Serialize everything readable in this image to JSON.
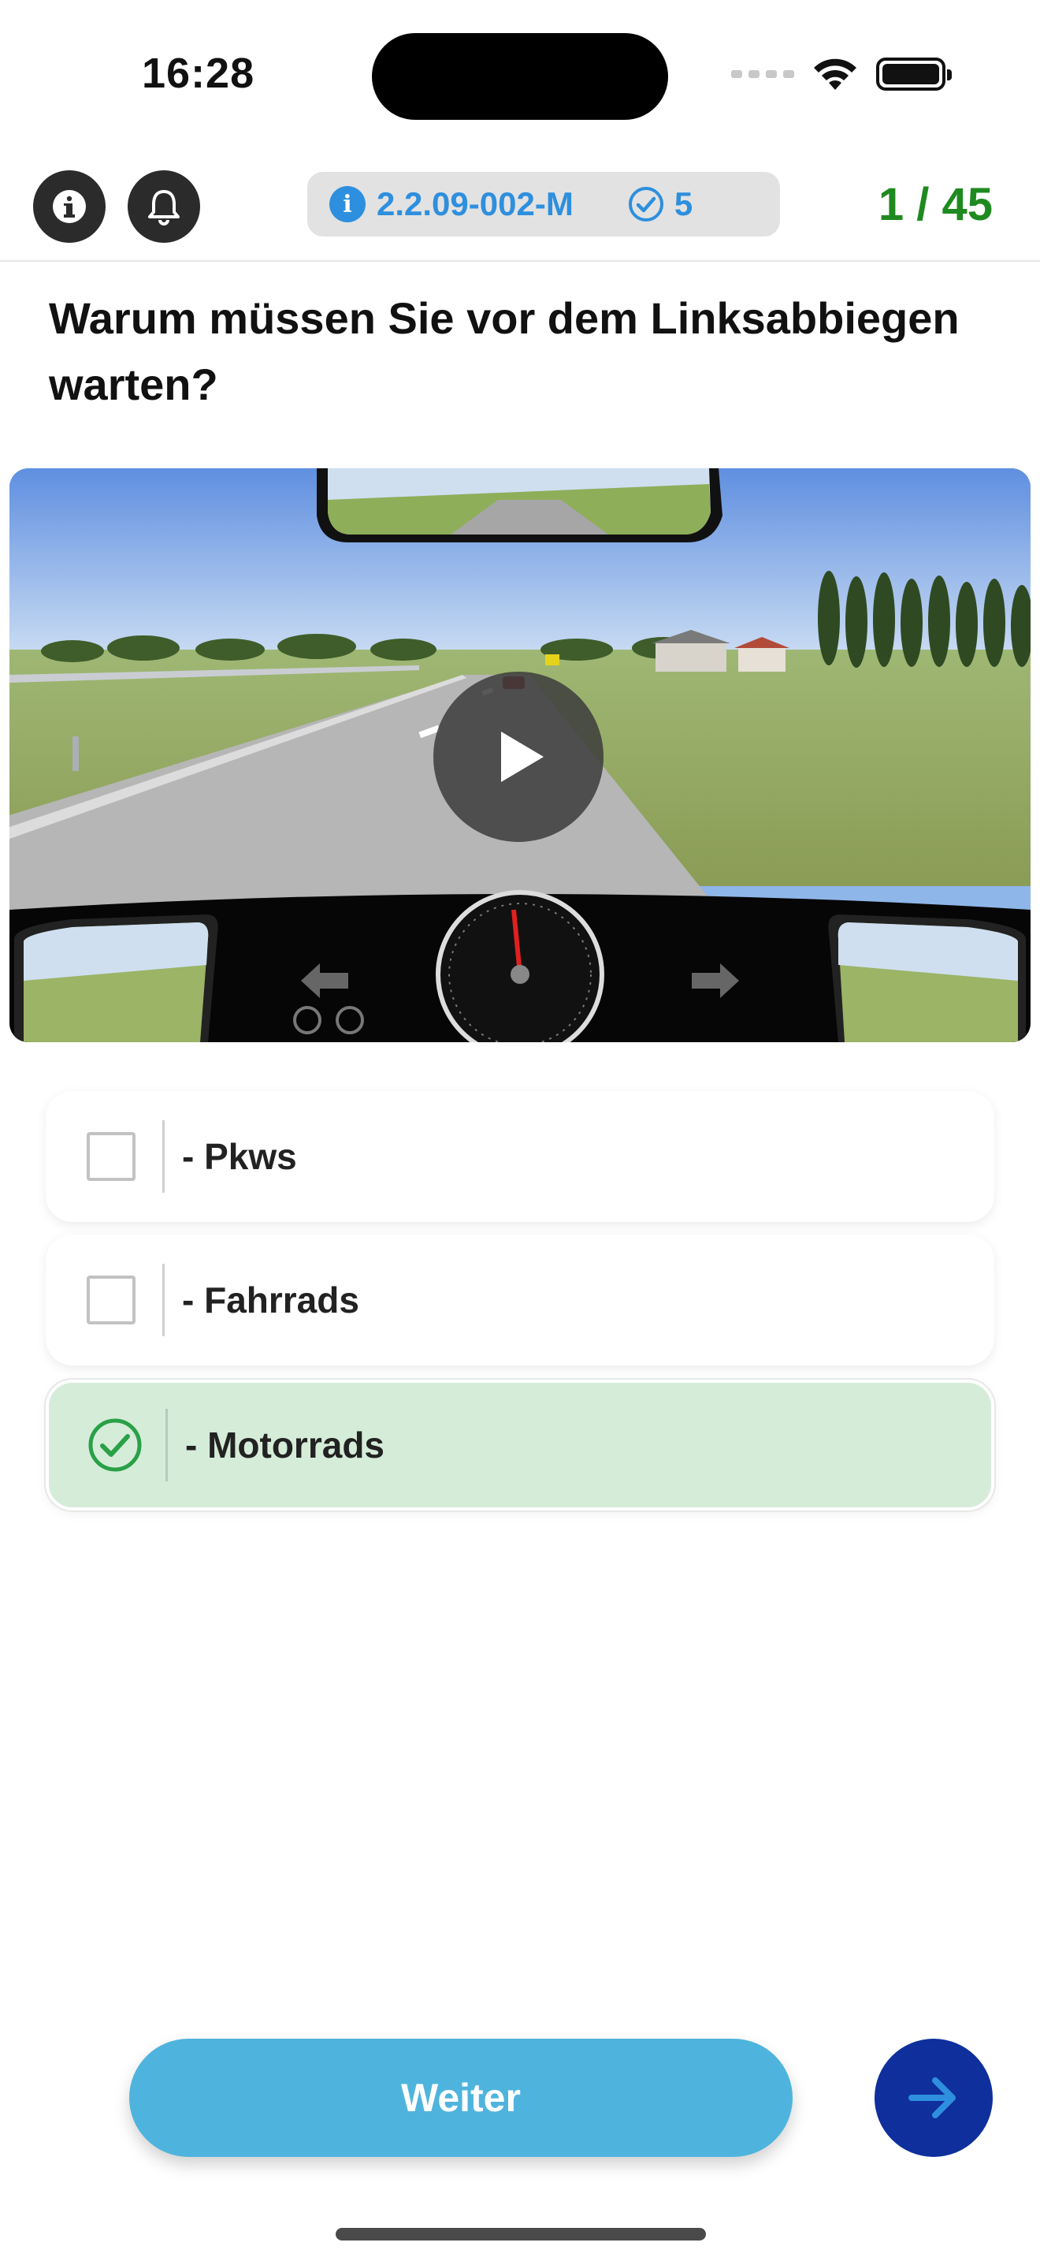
{
  "status_bar": {
    "time": "16:28"
  },
  "header": {
    "question_id": "2.2.09-002-M",
    "points": "5",
    "progress": "1 / 45"
  },
  "question": {
    "text": "Warum müssen Sie vor dem Linksabbiegen warten?"
  },
  "answers": [
    {
      "label": "- Pkws",
      "selected": false
    },
    {
      "label": "- Fahrrads",
      "selected": false
    },
    {
      "label": "- Motorrads",
      "selected": true
    }
  ],
  "footer": {
    "continue_label": "Weiter"
  },
  "colors": {
    "progress": "#1f8a1f",
    "chip_text": "#2e8fde",
    "selected_bg": "#d5ecd9",
    "selected_check": "#2aa047",
    "continue_button": "#4fb4dd",
    "next_button": "#0e2f9c"
  },
  "icons": {
    "info": "info-icon",
    "bell": "bell-icon",
    "check": "check-circle-icon",
    "play": "play-icon",
    "next": "arrow-right-icon"
  }
}
